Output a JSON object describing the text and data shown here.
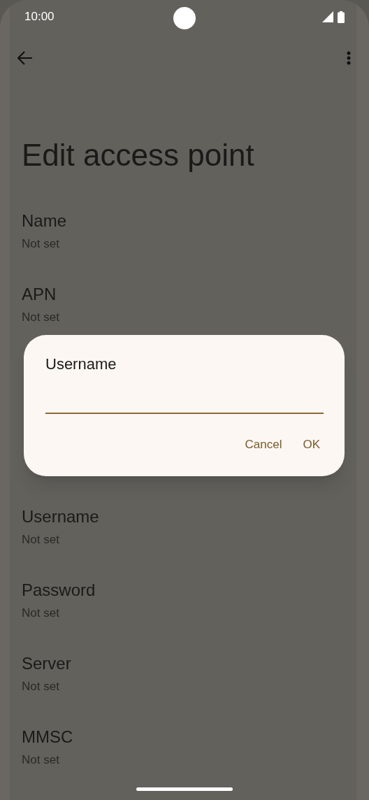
{
  "status_bar": {
    "time": "10:00"
  },
  "title": "Edit access point",
  "settings_above": [
    {
      "label": "Name",
      "value": "Not set"
    },
    {
      "label": "APN",
      "value": "Not set"
    }
  ],
  "settings_below": [
    {
      "label": "Username",
      "value": "Not set"
    },
    {
      "label": "Password",
      "value": "Not set"
    },
    {
      "label": "Server",
      "value": "Not set"
    },
    {
      "label": "MMSC",
      "value": "Not set"
    }
  ],
  "dialog": {
    "title": "Username",
    "buttons": [
      "Cancel",
      "OK"
    ]
  }
}
